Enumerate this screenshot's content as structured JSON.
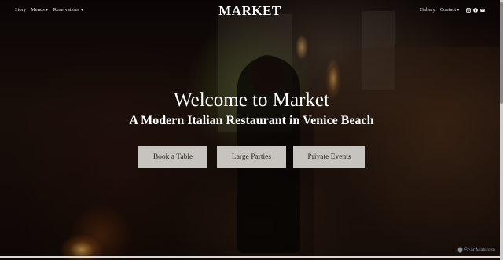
{
  "nav": {
    "left": [
      {
        "label": "Story",
        "has_dropdown": false
      },
      {
        "label": "Menus",
        "has_dropdown": true
      },
      {
        "label": "Reservations",
        "has_dropdown": true
      }
    ],
    "logo": "MARKET",
    "right": [
      {
        "label": "Gallery",
        "has_dropdown": false
      },
      {
        "label": "Contact",
        "has_dropdown": true
      }
    ],
    "social_icons": [
      "instagram-icon",
      "facebook-icon",
      "email-icon"
    ]
  },
  "hero": {
    "headline": "Welcome to Market",
    "subheadline": "A Modern Italian Restaurant in Venice Beach",
    "buttons": [
      "Book a Table",
      "Large Parties",
      "Private Events"
    ]
  },
  "badge": {
    "label": "ScanMalware"
  },
  "colors": {
    "button_bg": "#c7c4c0",
    "button_text": "#2a2624",
    "text": "#ffffff"
  }
}
